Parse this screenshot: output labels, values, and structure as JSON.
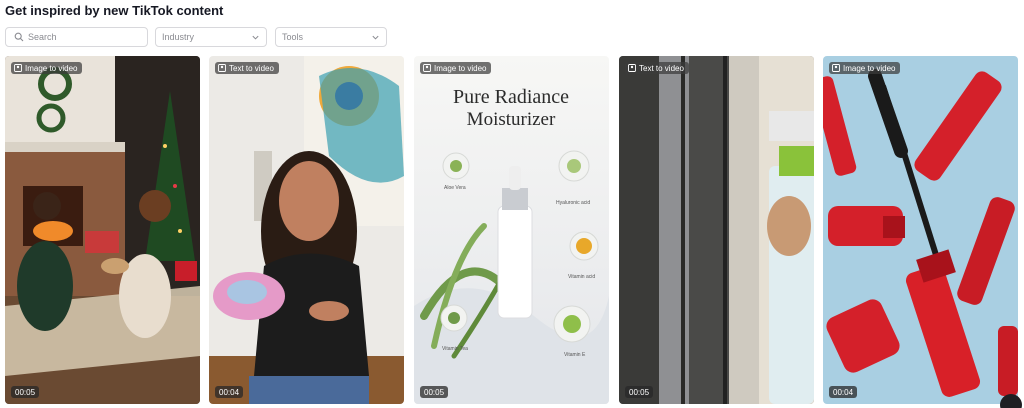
{
  "header": {
    "title": "Get inspired by new TikTok content"
  },
  "filters": {
    "search_placeholder": "Search",
    "industry_label": "Industry",
    "tools_label": "Tools"
  },
  "cards": [
    {
      "badge": "Image to video",
      "duration": "00:05",
      "icon": "christmas-couple-thumbnail"
    },
    {
      "badge": "Text to video",
      "duration": "00:04",
      "icon": "woman-makeup-pouch-thumbnail"
    },
    {
      "badge": "Image to video",
      "duration": "00:05",
      "icon": "moisturizer-product-thumbnail",
      "overlay": {
        "title_line1": "Pure Radiance",
        "title_line2": "Moisturizer",
        "ingredients": [
          "Aloe Vera",
          "Hyaluronic acid",
          "Vitamin acid",
          "Vitamin Tea",
          "Vitamin E"
        ]
      }
    },
    {
      "badge": "Text to video",
      "duration": "00:05",
      "icon": "window-cleaning-thumbnail"
    },
    {
      "badge": "Image to video",
      "duration": "00:04",
      "icon": "red-mascara-thumbnail"
    }
  ]
}
